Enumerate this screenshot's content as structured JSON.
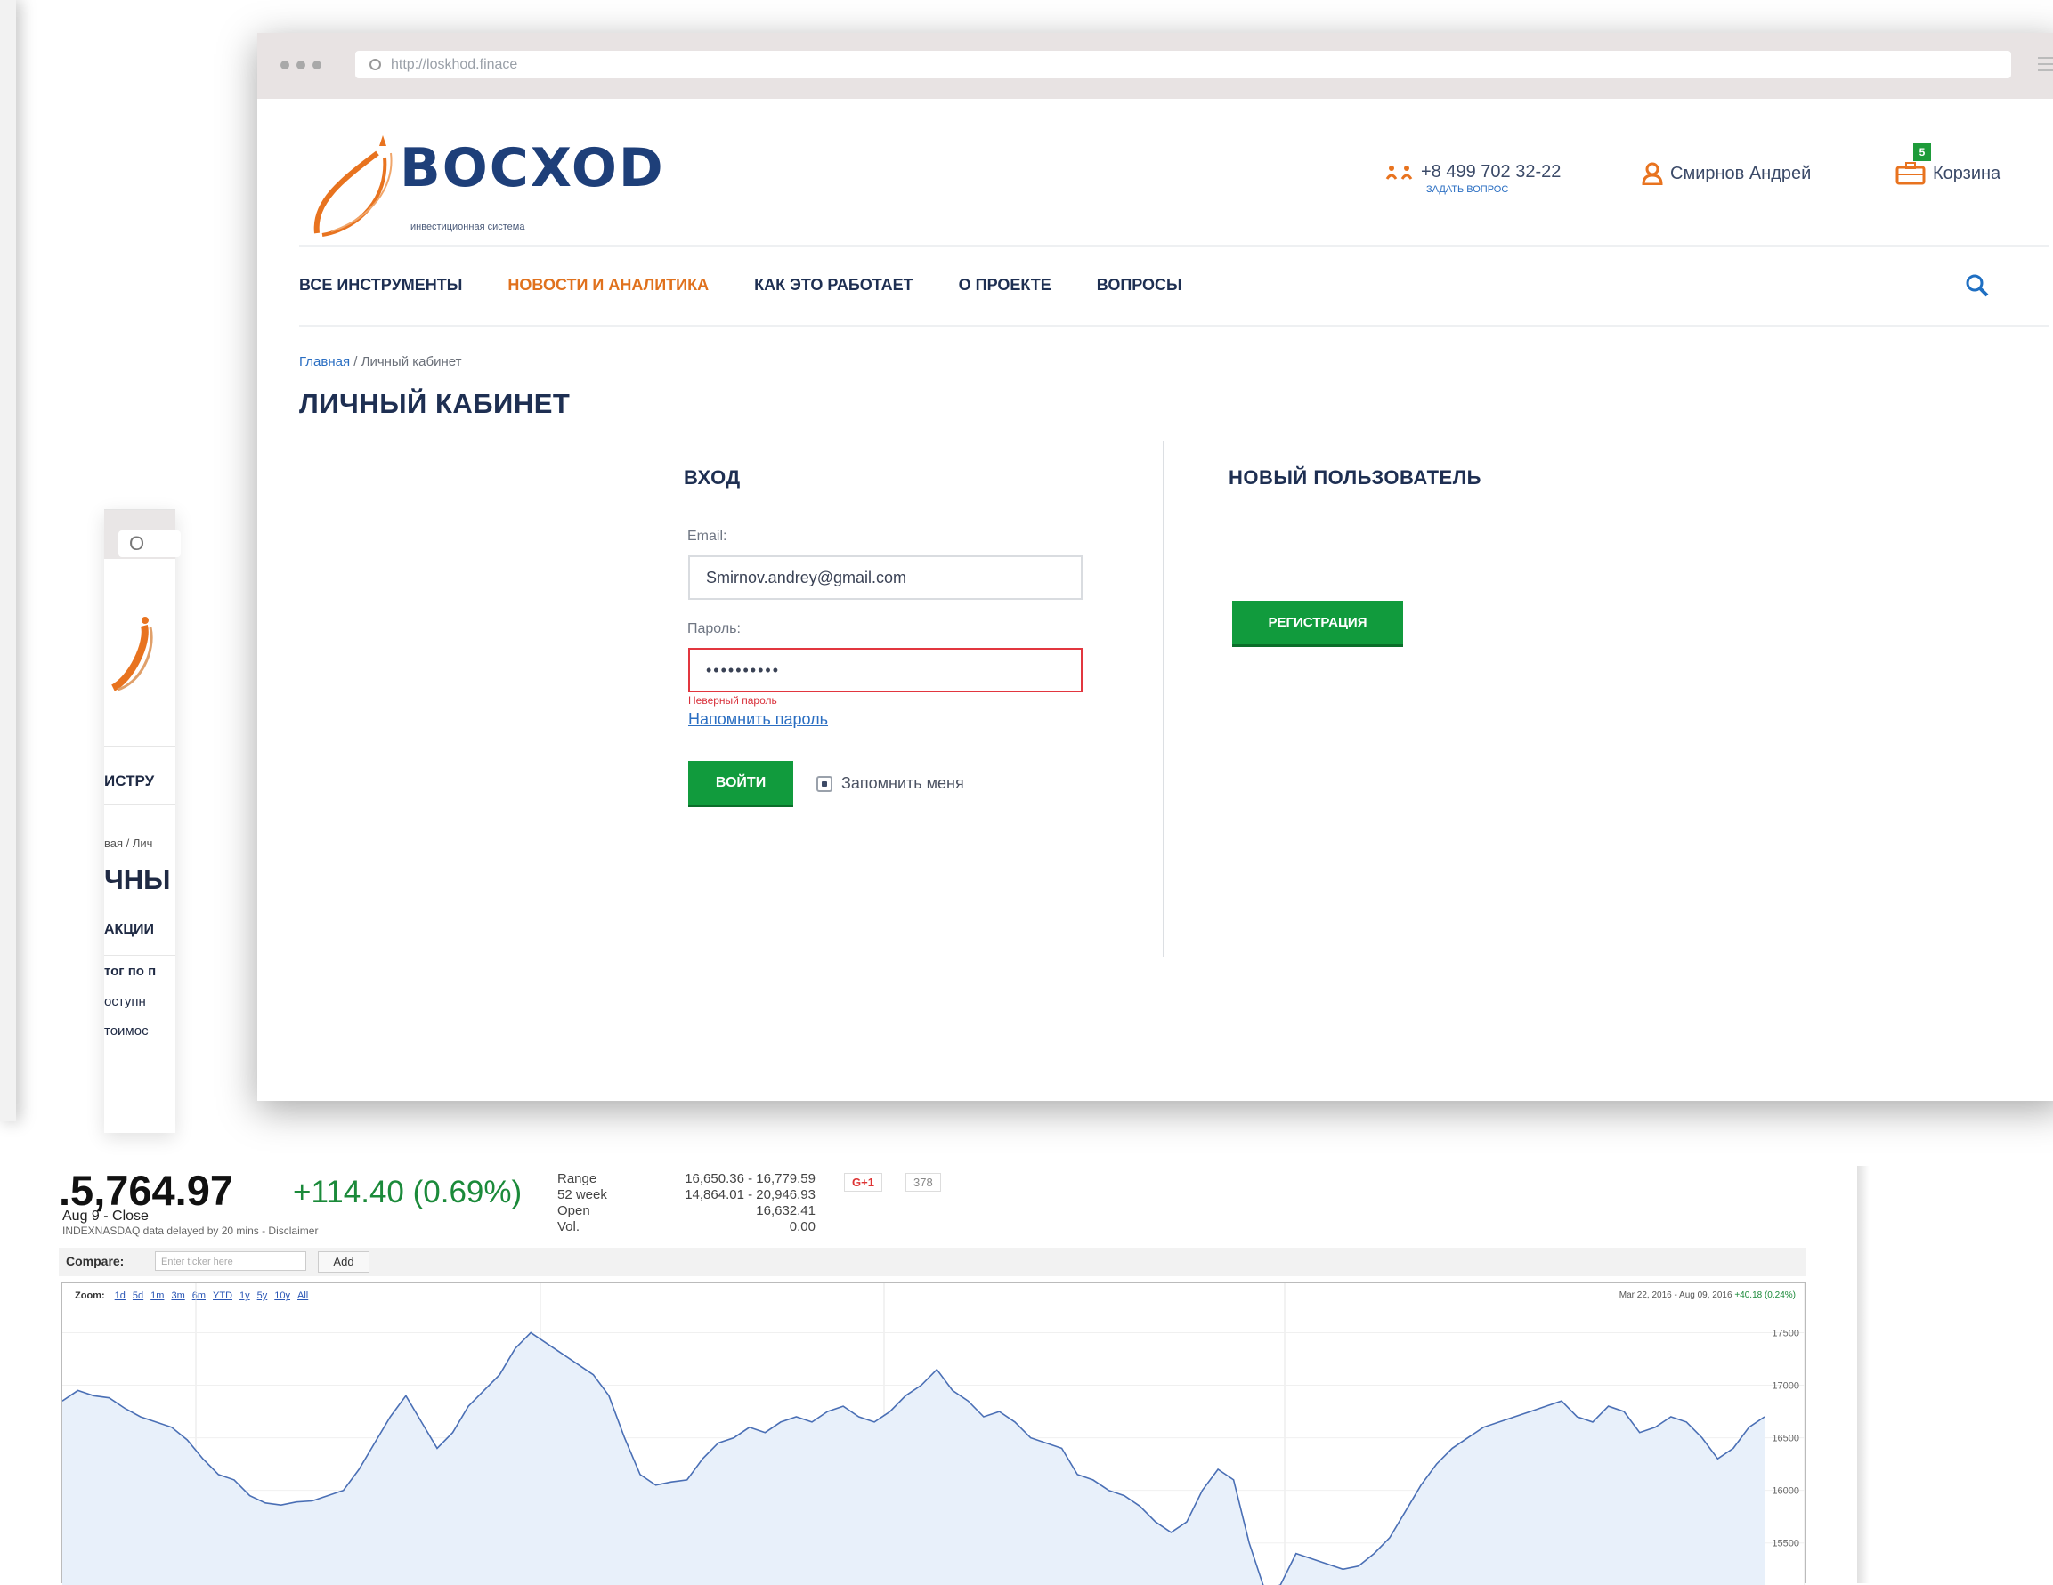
{
  "browser": {
    "url": "http://loskhod.finace"
  },
  "header": {
    "logo_word": "BOCXOD",
    "logo_sub": "инвестиционная система",
    "phone": "+8 499 702 32-22",
    "ask_question": "ЗАДАТЬ ВОПРОС",
    "user_name": "Смирнов Андрей",
    "cart_label": "Корзина",
    "cart_count": "5"
  },
  "nav": {
    "items": [
      {
        "label": "ВСЕ ИНСТРУМЕНТЫ",
        "active": false
      },
      {
        "label": "НОВОСТИ И АНАЛИТИКА",
        "active": true
      },
      {
        "label": "КАК ЭТО РАБОТАЕТ",
        "active": false
      },
      {
        "label": "О ПРОЕКТЕ",
        "active": false
      },
      {
        "label": "ВОПРОСЫ",
        "active": false
      }
    ]
  },
  "breadcrumb": {
    "home": "Главная",
    "current": "/ Личный кабинет"
  },
  "page_title": "ЛИЧНЫЙ КАБИНЕТ",
  "login": {
    "heading": "ВХОД",
    "email_label": "Email:",
    "email_value": "Smirnov.andrey@gmail.com",
    "password_label": "Пароль:",
    "password_value": "••••••••••",
    "password_error": "Неверный пароль",
    "remind_link": "Напомнить пароль",
    "submit_label": "ВОЙТИ",
    "remember_label": "Запомнить меня",
    "remember_checked": true
  },
  "register": {
    "heading": "НОВЫЙ ПОЛЬЗОВАТЕЛЬ",
    "button_label": "РЕГИСТРАЦИЯ"
  },
  "background_window": {
    "url_fragment": "O",
    "nav_fragment": "ИСТРУ",
    "crumb_fragment": "вая / Лич",
    "title_fragment": "ЧНЫ",
    "section_fragment": "АКЦИИ",
    "line1": "тог по п",
    "line2": "оступн",
    "line3": "тоимос"
  },
  "stock": {
    "price": ".5,764.97",
    "change": "+114.40 (0.69%)",
    "close_label": "Aug 9 - Close",
    "delay_note": "INDEXNASDAQ data delayed by 20 mins - Disclaimer",
    "stats": [
      {
        "k": "Range",
        "v": "16,650.36 - 16,779.59"
      },
      {
        "k": "52 week",
        "v": "14,864.01 - 20,946.93"
      },
      {
        "k": "Open",
        "v": "16,632.41"
      },
      {
        "k": "Vol.",
        "v": "0.00"
      }
    ],
    "gplus": "G+1",
    "gcount": "378",
    "compare_label": "Compare:",
    "compare_placeholder": "Enter ticker here",
    "add_label": "Add",
    "zoom_label": "Zoom:",
    "zoom_options": [
      "1d",
      "5d",
      "1m",
      "3m",
      "6m",
      "YTD",
      "1y",
      "5y",
      "10y",
      "All"
    ],
    "date_range": "Mar 22, 2016 - Aug 09, 2016",
    "range_change": "+40.18 (0.24%)"
  },
  "chart_data": {
    "type": "area",
    "title": "",
    "xlabel": "",
    "ylabel": "",
    "y_ticks": [
      15500,
      16000,
      16500,
      17000,
      17500
    ],
    "ylim": [
      15100,
      17800
    ],
    "x": [
      "Mar 22",
      "",
      "",
      "",
      "",
      "",
      "",
      "",
      "",
      "",
      "",
      "",
      "",
      "",
      "",
      "",
      "",
      "",
      "",
      "",
      "",
      "",
      "",
      "",
      "",
      "",
      "",
      "",
      "",
      "",
      "",
      "",
      "",
      "",
      "",
      "",
      "",
      "",
      "",
      "",
      "",
      "",
      "",
      "",
      "",
      "",
      "",
      "",
      "",
      "",
      "",
      "",
      "",
      "",
      "",
      "",
      "",
      "",
      "",
      "",
      "",
      "",
      "",
      "",
      "",
      "",
      "",
      "",
      "",
      "",
      "",
      "",
      "",
      "",
      "",
      "",
      "",
      "",
      "",
      "",
      "",
      "",
      "Aug 09"
    ],
    "series": [
      {
        "values": [
          16850,
          16950,
          16900,
          16880,
          16780,
          16700,
          16650,
          16600,
          16480,
          16300,
          16150,
          16100,
          15950,
          15880,
          15860,
          15890,
          15900,
          15950,
          16000,
          16200,
          16450,
          16700,
          16900,
          16650,
          16400,
          16550,
          16800,
          16950,
          17100,
          17350,
          17500,
          17400,
          17300,
          17200,
          17100,
          16900,
          16500,
          16150,
          16050,
          16080,
          16100,
          16300,
          16450,
          16500,
          16600,
          16550,
          16650,
          16700,
          16650,
          16750,
          16800,
          16700,
          16650,
          16750,
          16900,
          17000,
          17150,
          16950,
          16850,
          16700,
          16750,
          16650,
          16500,
          16450,
          16400,
          16150,
          16100,
          16000,
          15950,
          15850,
          15700,
          15600,
          15700,
          16000,
          16200,
          16100,
          15500,
          15050,
          15100,
          15400,
          15350,
          15300,
          15250,
          15280,
          15400,
          15550,
          15800,
          16050,
          16250,
          16400,
          16500,
          16600,
          16650,
          16700,
          16750,
          16800,
          16850,
          16700,
          16650,
          16800,
          16750,
          16550,
          16600,
          16700,
          16650,
          16500,
          16300,
          16400,
          16600,
          16700
        ]
      }
    ]
  }
}
